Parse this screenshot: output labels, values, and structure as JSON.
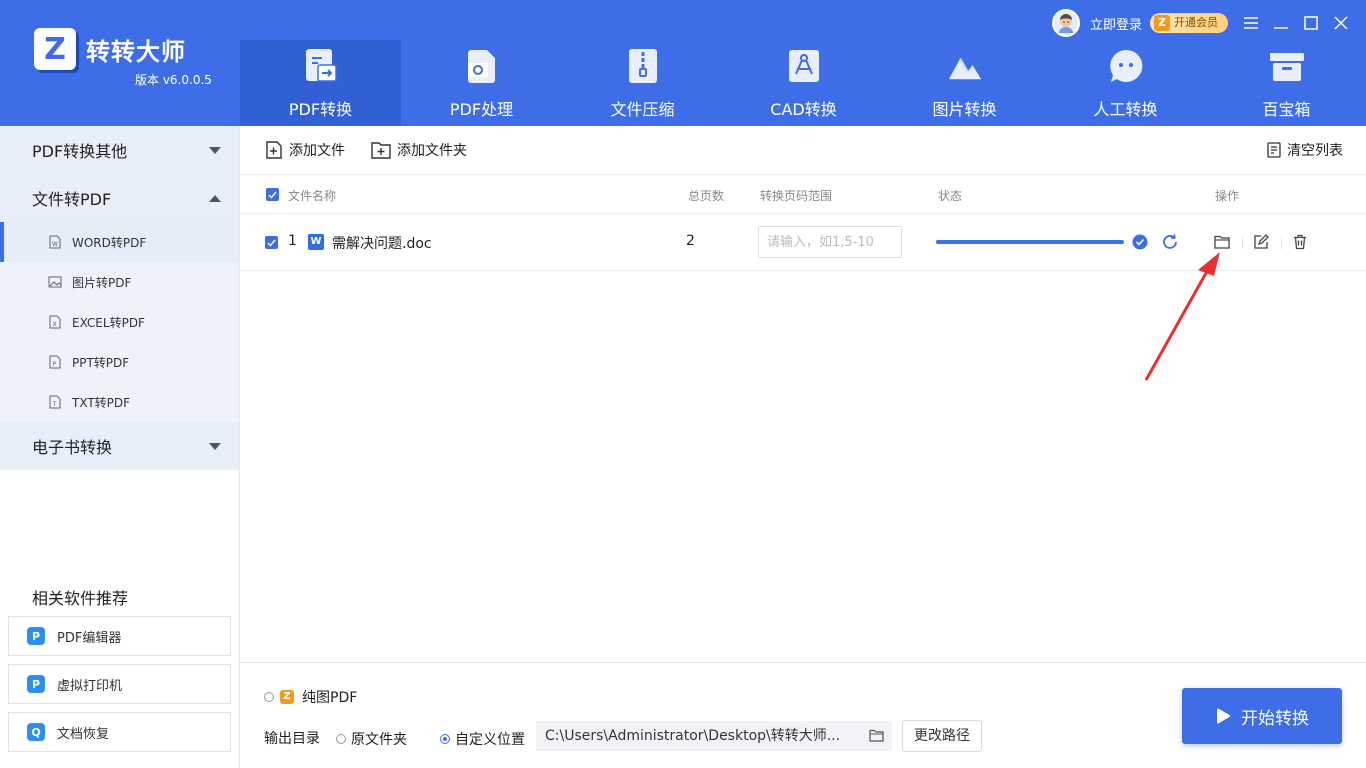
{
  "app": {
    "name": "转转大师",
    "version": "版本 v6.0.0.5",
    "logo_letter": "Z"
  },
  "user": {
    "login": "立即登录",
    "vip": "开通会员"
  },
  "topnav": [
    {
      "label": "PDF转换",
      "icon": "pdf-convert-icon"
    },
    {
      "label": "PDF处理",
      "icon": "pdf-process-icon"
    },
    {
      "label": "文件压缩",
      "icon": "zip-icon"
    },
    {
      "label": "CAD转换",
      "icon": "cad-icon"
    },
    {
      "label": "图片转换",
      "icon": "image-icon"
    },
    {
      "label": "人工转换",
      "icon": "chat-icon"
    },
    {
      "label": "百宝箱",
      "icon": "toolbox-icon"
    }
  ],
  "sidebar": {
    "categories": [
      {
        "label": "PDF转换其他"
      },
      {
        "label": "文件转PDF"
      },
      {
        "label": "电子书转换"
      }
    ],
    "subitems": [
      {
        "label": "WORD转PDF",
        "icon": "word-icon"
      },
      {
        "label": "图片转PDF",
        "icon": "image-icon"
      },
      {
        "label": "EXCEL转PDF",
        "icon": "excel-icon"
      },
      {
        "label": "PPT转PDF",
        "icon": "ppt-icon"
      },
      {
        "label": "TXT转PDF",
        "icon": "txt-icon"
      }
    ],
    "related_title": "相关软件推荐",
    "related": [
      {
        "label": "PDF编辑器",
        "color": "#2b8ff0"
      },
      {
        "label": "虚拟打印机",
        "color": "#2b8ff0"
      },
      {
        "label": "文档恢复",
        "color": "#2b8ff0"
      }
    ]
  },
  "toolbar": {
    "add_file": "添加文件",
    "add_folder": "添加文件夹",
    "clear_list": "清空列表"
  },
  "table": {
    "headers": {
      "name": "文件名称",
      "pages": "总页数",
      "range": "转换页码范围",
      "status": "状态",
      "ops": "操作"
    },
    "rows": [
      {
        "index": "1",
        "filename": "需解决问题.doc",
        "pages": "2",
        "range_placeholder": "请输入，如1,5-10",
        "progress": 1.0
      }
    ]
  },
  "bottom": {
    "pure_image_pdf": "纯图PDF",
    "output_dir_label": "输出目录",
    "opt_original": "原文件夹",
    "opt_custom": "自定义位置",
    "path": "C:\\Users\\Administrator\\Desktop\\转转大师...",
    "change_path": "更改路径",
    "start": "开始转换"
  },
  "colors": {
    "brand": "#3d6ee8",
    "brand_dark": "#3160d4",
    "annotation_arrow": "#e8312f"
  }
}
